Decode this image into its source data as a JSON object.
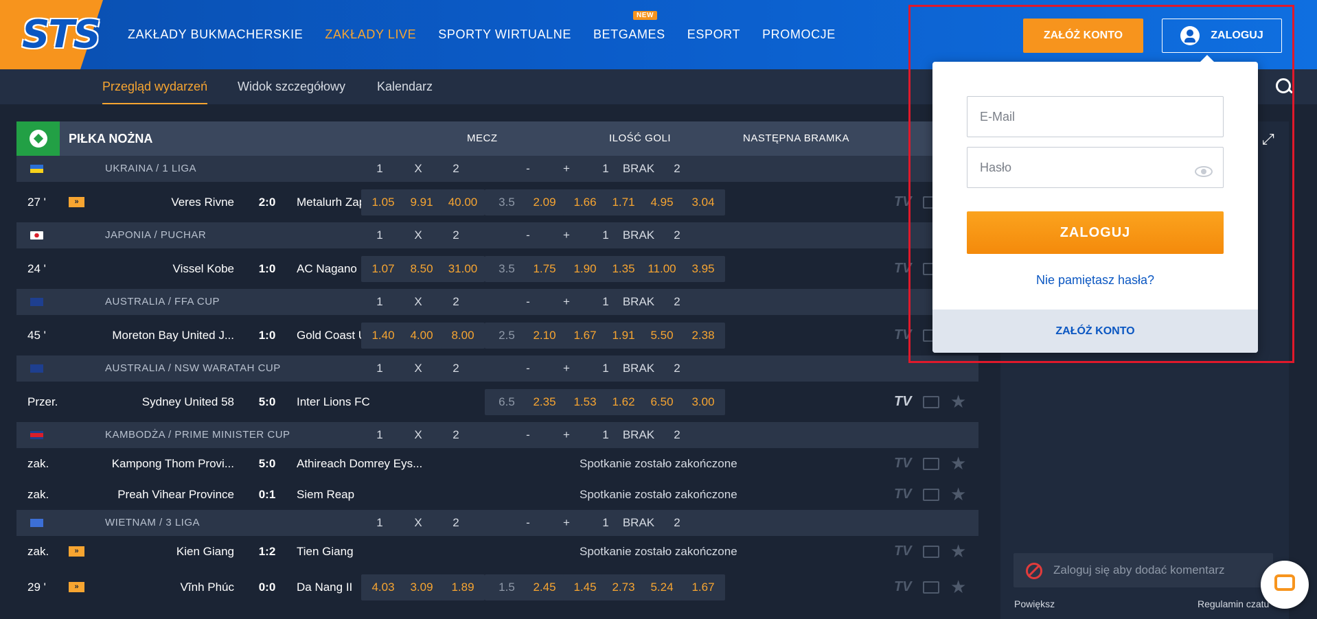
{
  "header": {
    "logo_text": "STS",
    "nav": [
      "ZAKŁADY BUKMACHERSKIE",
      "ZAKŁADY LIVE",
      "SPORTY WIRTUALNE",
      "BETGAMES",
      "ESPORT",
      "PROMOCJE"
    ],
    "new_badge": "NEW",
    "register_label": "ZAŁÓŻ KONTO",
    "login_label": "ZALOGUJ"
  },
  "subnav": [
    "Przegląd wydarzeń",
    "Widok szczegółowy",
    "Kalendarz"
  ],
  "sport": {
    "name": "PIŁKA NOŻNA",
    "markets": [
      "MECZ",
      "ILOŚĆ GOLI",
      "NASTĘPNA BRAMKA"
    ],
    "cols": [
      "1",
      "X",
      "2",
      "-",
      "+",
      "1",
      "BRAK",
      "2"
    ]
  },
  "leagues": [
    {
      "name": "UKRAINA / 1 LIGA",
      "matches": [
        {
          "time": "27 '",
          "home": "Veres Rivne",
          "score": "2:0",
          "away": "Metalurh Zaporizhya",
          "odds": [
            "1.05",
            "9.91",
            "40.00",
            "3.5",
            "2.09",
            "1.66",
            "1.71",
            "4.95",
            "3.04"
          ]
        }
      ]
    },
    {
      "name": "JAPONIA / PUCHAR",
      "matches": [
        {
          "time": "24 '",
          "home": "Vissel Kobe",
          "score": "1:0",
          "away": "AC Nagano Parceiro",
          "odds": [
            "1.07",
            "8.50",
            "31.00",
            "3.5",
            "1.75",
            "1.90",
            "1.35",
            "11.00",
            "3.95"
          ]
        }
      ]
    },
    {
      "name": "AUSTRALIA / FFA CUP",
      "matches": [
        {
          "time": "45 '",
          "home": "Moreton Bay United J...",
          "score": "1:0",
          "away": "Gold Coast United",
          "odds": [
            "1.40",
            "4.00",
            "8.00",
            "2.5",
            "2.10",
            "1.67",
            "1.91",
            "5.50",
            "2.38"
          ]
        }
      ]
    },
    {
      "name": "AUSTRALIA / NSW WARATAH CUP",
      "matches": [
        {
          "time": "Przer.",
          "home": "Sydney United 58",
          "score": "5:0",
          "away": "Inter Lions FC",
          "odds": [
            "",
            "",
            "",
            "6.5",
            "2.35",
            "1.53",
            "1.62",
            "6.50",
            "3.00"
          ]
        }
      ]
    },
    {
      "name": "KAMBODŻA / PRIME MINISTER CUP",
      "matches": [
        {
          "time": "zak.",
          "home": "Kampong Thom Provi...",
          "score": "5:0",
          "away": "Athireach Domrey Eys...",
          "status": "Spotkanie zostało zakończone"
        },
        {
          "time": "zak.",
          "home": "Preah Vihear Province",
          "score": "0:1",
          "away": "Siem Reap",
          "status": "Spotkanie zostało zakończone"
        }
      ]
    },
    {
      "name": "WIETNAM / 3 LIGA",
      "matches": [
        {
          "time": "zak.",
          "home": "Kien Giang",
          "score": "1:2",
          "away": "Tien Giang",
          "status": "Spotkanie zostało zakończone"
        },
        {
          "time": "29 '",
          "home": "Vĩnh Phúc",
          "score": "0:0",
          "away": "Da Nang II",
          "odds": [
            "4.03",
            "3.09",
            "1.89",
            "1.5",
            "2.45",
            "1.45",
            "2.73",
            "5.24",
            "1.67"
          ]
        }
      ]
    }
  ],
  "tv_label": "TV",
  "login_form": {
    "email_placeholder": "E-Mail",
    "password_placeholder": "Hasło",
    "submit_label": "ZALOGUJ",
    "forgot_label": "Nie pamiętasz hasła?",
    "register_label": "ZAŁÓŻ KONTO"
  },
  "right_panel": {
    "comment_placeholder": "Zaloguj się aby dodać komentarz",
    "enlarge_label": "Powiększ",
    "rules_label": "Regulamin czatu"
  },
  "colors": {
    "accent": "#f7941d",
    "brand": "#0b5cc9",
    "highlight": "#e0192b"
  }
}
